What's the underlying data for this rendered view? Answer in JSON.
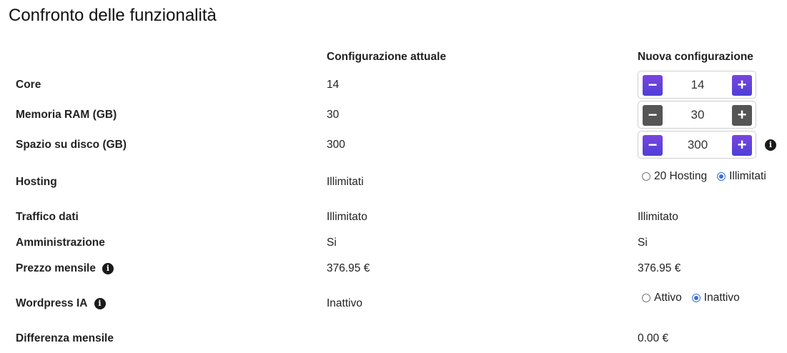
{
  "title": "Confronto delle funzionalità",
  "columns": {
    "current": "Configurazione attuale",
    "new": "Nuova configurazione"
  },
  "rows": {
    "core": {
      "label": "Core",
      "current": "14",
      "new_value": "14"
    },
    "ram": {
      "label": "Memoria RAM (GB)",
      "current": "30",
      "new_value": "30"
    },
    "disk": {
      "label": "Spazio su disco (GB)",
      "current": "300",
      "new_value": "300"
    },
    "hosting": {
      "label": "Hosting",
      "current": "Illimitati",
      "options": [
        "20 Hosting",
        "Illimitati"
      ],
      "selected": "Illimitati"
    },
    "traffic": {
      "label": "Traffico dati",
      "current": "Illimitato",
      "new_value": "Illimitato"
    },
    "admin": {
      "label": "Amministrazione",
      "current": "Si",
      "new_value": "Si"
    },
    "price": {
      "label": "Prezzo mensile",
      "current": "376.95 €",
      "new_value": "376.95 €"
    },
    "wordpress": {
      "label": "Wordpress IA",
      "current": "Inattivo",
      "options": [
        "Attivo",
        "Inattivo"
      ],
      "selected": "Inattivo"
    },
    "diff": {
      "label": "Differenza mensile",
      "current": "",
      "new_value": "0.00 €"
    }
  },
  "stepper": {
    "minus": "−",
    "plus": "+"
  },
  "info_glyph": "i",
  "colors": {
    "accent": "#5a40da",
    "disabled": "#555555",
    "radio": "#3b6fd6"
  }
}
